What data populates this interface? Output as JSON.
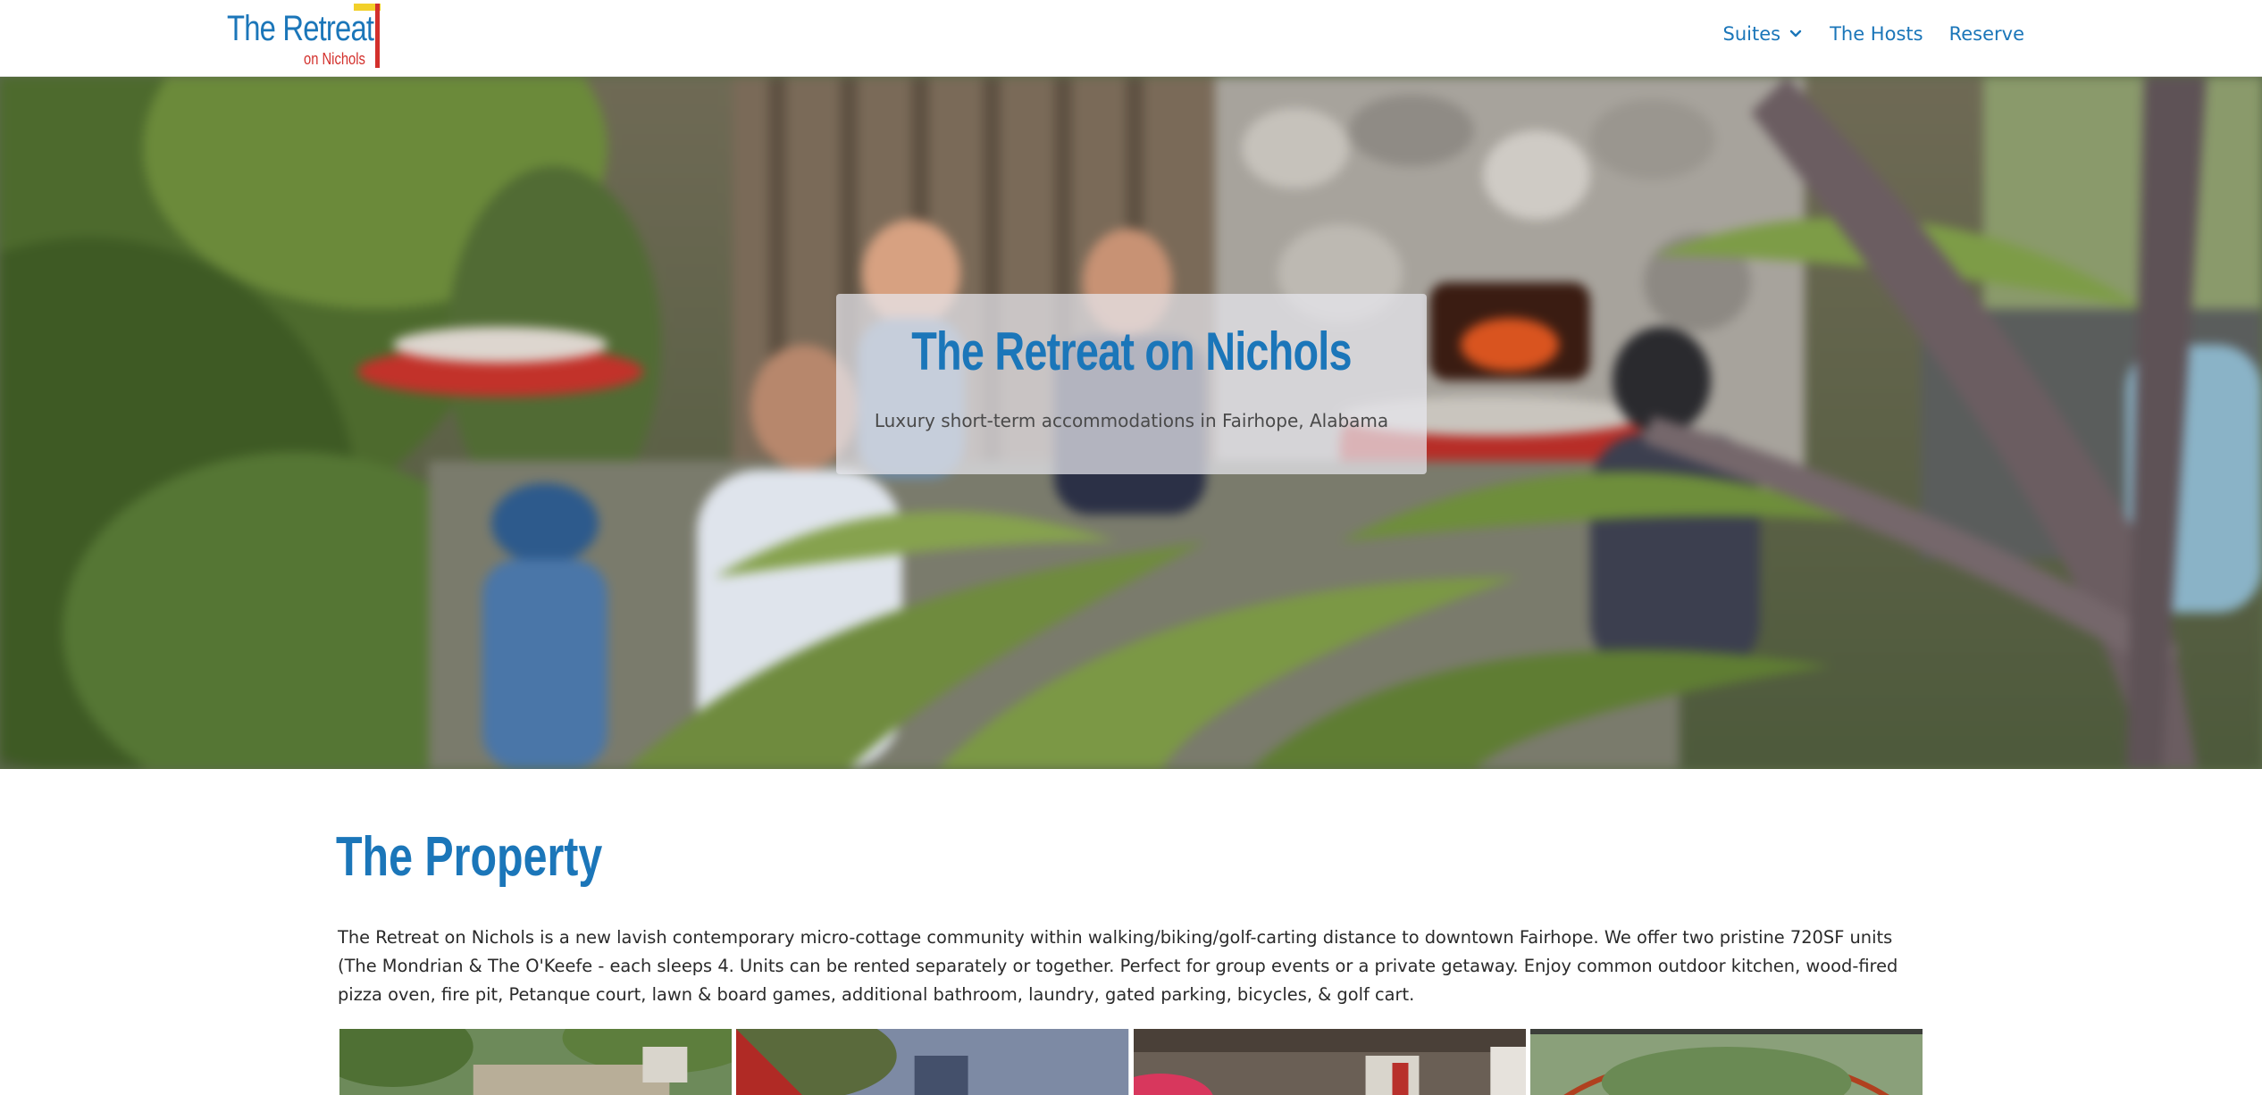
{
  "header": {
    "logo": {
      "main": "The Retreat",
      "sub": "on Nichols"
    },
    "nav": [
      {
        "label": "Suites",
        "has_dropdown": true,
        "icon": "chevron-down-icon"
      },
      {
        "label": "The Hosts"
      },
      {
        "label": "Reserve"
      }
    ]
  },
  "hero": {
    "title": "The Retreat on Nichols",
    "subtitle": "Luxury short-term accommodations in Fairhope, Alabama"
  },
  "property": {
    "heading": "The Property",
    "description": "The Retreat on Nichols is a new lavish contemporary micro-cottage community within walking/biking/golf-carting distance to downtown Fairhope. We offer two pristine 720SF units (The Mondrian & The O'Keefe - each sleeps 4. Units can be rented separately or together. Perfect for group events or a private getaway. Enjoy common outdoor kitchen, wood-fired pizza oven, fire pit, Petanque court, lawn & board games, additional bathroom, laundry, gated parking, bicycles, & golf cart."
  },
  "colors": {
    "brand_blue": "#1b76b9",
    "brand_red": "#d3302c",
    "brand_yellow": "#f2d02a",
    "text_dark": "#2a2a2a"
  }
}
